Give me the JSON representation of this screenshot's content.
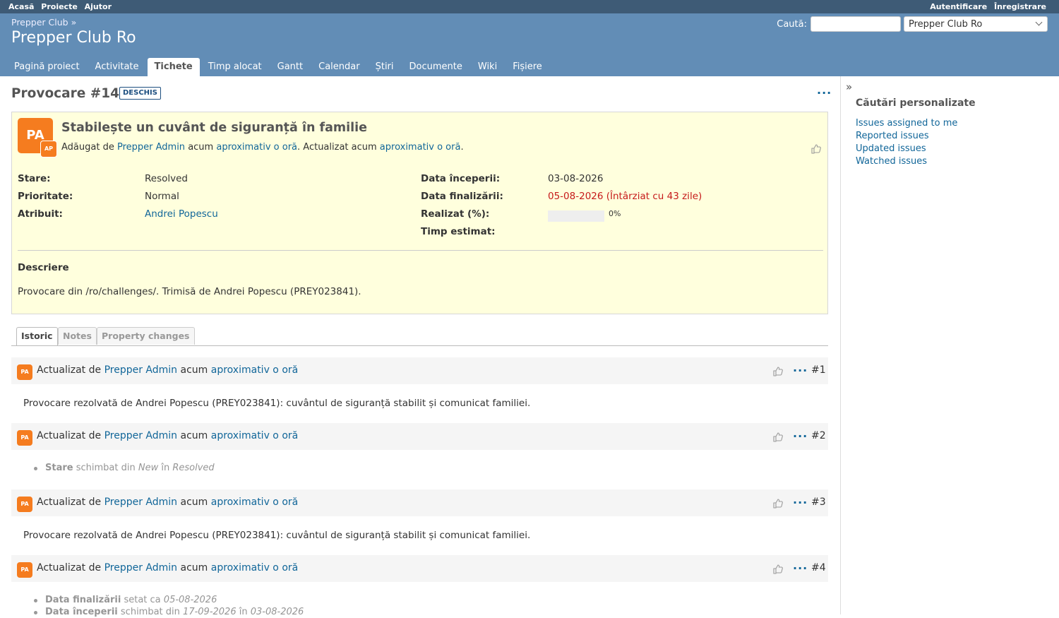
{
  "top_menu": {
    "left": [
      "Acasă",
      "Proiecte",
      "Ajutor"
    ],
    "right": [
      "Autentificare",
      "Înregistrare"
    ]
  },
  "header": {
    "parent": "Prepper Club »",
    "title": "Prepper Club Ro",
    "search_label": "Caută:",
    "search_value": "",
    "project_select": "Prepper Club Ro"
  },
  "main_menu": [
    "Pagină proiect",
    "Activitate",
    "Tichete",
    "Timp alocat",
    "Gantt",
    "Calendar",
    "Știri",
    "Documente",
    "Wiki",
    "Fișiere"
  ],
  "issue": {
    "title": "Provocare #14",
    "status_badge": "DESCHIS",
    "more": "···",
    "avatar": "PA",
    "avatar_small": "AP",
    "subject": "Stabilește un cuvânt de siguranță în familie",
    "added_prefix": "Adăugat de",
    "author": "Prepper Admin",
    "added_mid": "acum",
    "added_time": "aproximativ o oră",
    "updated_prefix": ". Actualizat acum",
    "updated_time": "aproximativ o oră",
    "updated_suffix": ".",
    "attributes": {
      "status_k": "Stare:",
      "status_v": "Resolved",
      "priority_k": "Prioritate:",
      "priority_v": "Normal",
      "assignee_k": "Atribuit:",
      "assignee_v": "Andrei Popescu",
      "start_k": "Data începerii:",
      "start_v": "03-08-2026",
      "due_k": "Data finalizării:",
      "due_v": "05-08-2026 (Întârziat cu 43 zile)",
      "done_k": "Realizat (%):",
      "done_v": "0%",
      "done_ratio": 0,
      "estimated_k": "Timp estimat:"
    },
    "description_h": "Descriere",
    "description": "Provocare din /ro/challenges/. Trimisă de Andrei Popescu (PREY023841)."
  },
  "tabs": [
    "Istoric",
    "Notes",
    "Property changes"
  ],
  "journals": [
    {
      "avatar": "PA",
      "prefix": "Actualizat de",
      "author": "Prepper Admin",
      "mid": "acum",
      "time": "aproximativ o oră",
      "num": "#1",
      "note": "Provocare rezolvată de Andrei Popescu (PREY023841): cuvântul de siguranță stabilit și comunicat familiei."
    },
    {
      "avatar": "PA",
      "prefix": "Actualizat de",
      "author": "Prepper Admin",
      "mid": "acum",
      "time": "aproximativ o oră",
      "num": "#2",
      "detail": {
        "field": "Stare",
        "verb": "schimbat din",
        "from": "New",
        "conj": "în",
        "to": "Resolved"
      }
    },
    {
      "avatar": "PA",
      "prefix": "Actualizat de",
      "author": "Prepper Admin",
      "mid": "acum",
      "time": "aproximativ o oră",
      "num": "#3",
      "note": "Provocare rezolvată de Andrei Popescu (PREY023841): cuvântul de siguranță stabilit și comunicat familiei."
    },
    {
      "avatar": "PA",
      "prefix": "Actualizat de",
      "author": "Prepper Admin",
      "mid": "acum",
      "time": "aproximativ o oră",
      "num": "#4",
      "details": [
        {
          "field": "Data finalizării",
          "verb": "setat ca",
          "value": "05-08-2026"
        },
        {
          "field": "Data începerii",
          "verb": "schimbat din",
          "from": "17-09-2026",
          "conj": "în",
          "to": "03-08-2026"
        }
      ]
    }
  ],
  "sidebar": {
    "heading": "Căutări personalizate",
    "items": [
      "Issues assigned to me",
      "Reported issues",
      "Updated issues",
      "Watched issues"
    ]
  },
  "colors": {
    "header": "#628DB6",
    "top_menu": "#3E5B76",
    "avatar": "#f57c1f",
    "issue_bg": "#ffffdd",
    "link": "#1166aa",
    "overdue": "#c61a1a"
  }
}
